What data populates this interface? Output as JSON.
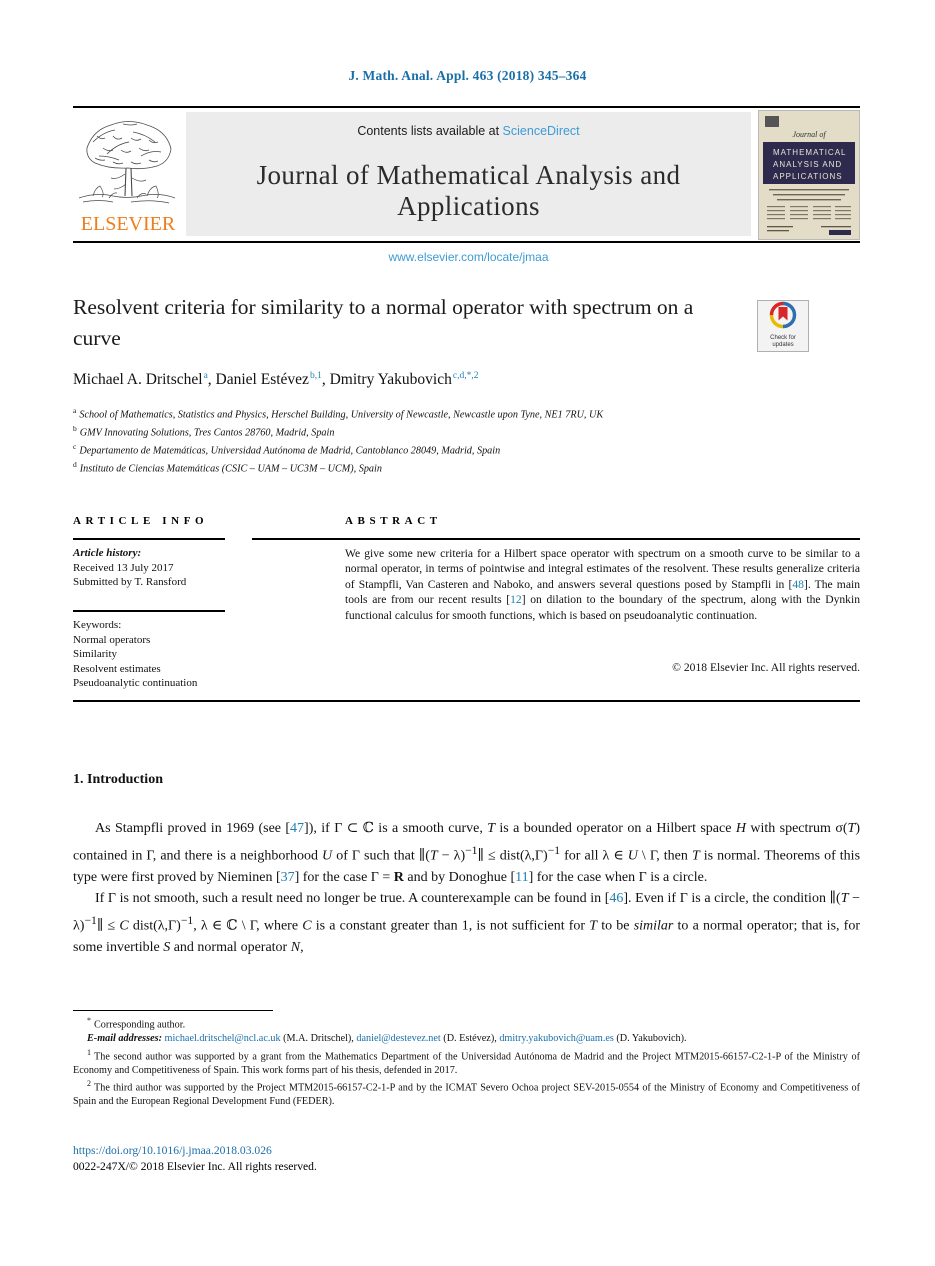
{
  "running_head": "J. Math. Anal. Appl. 463 (2018) 345–364",
  "masthead": {
    "contents_prefix": "Contents lists available at ",
    "sciencedirect": "ScienceDirect",
    "journal_name": "Journal of Mathematical Analysis and Applications",
    "journal_url": "www.elsevier.com/locate/jmaa",
    "publisher_wordmark": "ELSEVIER",
    "cover_journal_of": "Journal of",
    "cover_title_line1": "MATHEMATICAL",
    "cover_title_line2": "ANALYSIS AND",
    "cover_title_line3": "APPLICATIONS"
  },
  "crossmark": {
    "line1": "Check for",
    "line2": "updates"
  },
  "article": {
    "title": "Resolvent criteria for similarity to a normal operator with spectrum on a curve",
    "authors_html": "Michael A. Dritschel<sup>a</sup>, Daniel Estévez<sup>b,1</sup>, Dmitry Yakubovich<sup>c,d,*,2</sup>",
    "affiliations": [
      {
        "mark": "a",
        "text": "School of Mathematics, Statistics and Physics, Herschel Building, University of Newcastle, Newcastle upon Tyne, NE1 7RU, UK"
      },
      {
        "mark": "b",
        "text": "GMV Innovating Solutions, Tres Cantos 28760, Madrid, Spain"
      },
      {
        "mark": "c",
        "text": "Departamento de Matemáticas, Universidad Autónoma de Madrid, Cantoblanco 28049, Madrid, Spain"
      },
      {
        "mark": "d",
        "text": "Instituto de Ciencias Matemáticas (CSIC – UAM – UC3M – UCM), Spain"
      }
    ]
  },
  "info": {
    "header": "ARTICLE INFO",
    "history_head": "Article history:",
    "received": "Received 13 July 2017",
    "submitted": "Submitted by T. Ransford",
    "keywords_head": "Keywords:",
    "keywords": [
      "Normal operators",
      "Similarity",
      "Resolvent estimates",
      "Pseudoanalytic continuation"
    ]
  },
  "abstract": {
    "header": "ABSTRACT",
    "text_html": "We give some new criteria for a Hilbert space operator with spectrum on a smooth curve to be similar to a normal operator, in terms of pointwise and integral estimates of the resolvent. These results generalize criteria of Stampfli, Van Casteren and Naboko, and answers several questions posed by Stampfli in [<span class=\"cit\">48</span>]. The main tools are from our recent results [<span class=\"cit\">12</span>] on dilation to the boundary of the spectrum, along with the Dynkin functional calculus for smooth functions, which is based on pseudoanalytic continuation.",
    "copyright": "© 2018 Elsevier Inc. All rights reserved."
  },
  "section": {
    "heading": "1. Introduction",
    "paragraph1_html": "As Stampfli proved in 1969 (see [<span class=\"cit\">47</span>]), if &Gamma; &sub; &#8450; is a smooth curve, <span class=\"mi\">T</span> is a bounded operator on a Hilbert space <span class=\"mi\">H</span> with spectrum &sigma;(<span class=\"mi\">T</span>) contained in &Gamma;, and there is a neighborhood <span class=\"mi\">U</span> of &Gamma; such that &#8741;(<span class=\"mi\">T</span> &minus; &lambda;)<sup>&minus;1</sup>&#8741; &le; dist(&lambda;,&Gamma;)<sup>&minus;1</sup> for all &lambda; &isin; <span class=\"mi\">U</span> \\ &Gamma;, then <span class=\"mi\">T</span> is normal. Theorems of this type were first proved by Nieminen [<span class=\"cit\">37</span>] for the case &Gamma; = <span class=\"bb\">R</span> and by Donoghue [<span class=\"cit\">11</span>] for the case when &Gamma; is a circle.",
    "paragraph2_html": "If &Gamma; is not smooth, such a result need no longer be true. A counterexample can be found in [<span class=\"cit\">46</span>]. Even if &Gamma; is a circle, the condition &#8741;(<span class=\"mi\">T</span> &minus; &lambda;)<sup>&minus;1</sup>&#8741; &le; <span class=\"mi\">C</span> dist(&lambda;,&Gamma;)<sup>&minus;1</sup>, &lambda; &isin; &#8450; \\ &Gamma;, where <span class=\"mi\">C</span> is a constant greater than 1, is not sufficient for <span class=\"mi\">T</span> to be <span class=\"mi\">similar</span> to a normal operator; that is, for some invertible <span class=\"mi\">S</span> and normal operator <span class=\"mi\">N</span>,"
  },
  "footnotes": {
    "corresponding": "Corresponding author.",
    "emails_html": "<span class=\"ital\">E-mail addresses:</span> <span class=\"lnk\">michael.dritschel@ncl.ac.uk</span> (M.A. Dritschel), <span class=\"lnk\">daniel@destevez.net</span> (D. Estévez), <span class=\"lnk\">dmitry.yakubovich@uam.es</span> (D. Yakubovich).",
    "note1": "The second author was supported by a grant from the Mathematics Department of the Universidad Autónoma de Madrid and the Project MTM2015-66157-C2-1-P of the Ministry of Economy and Competitiveness of Spain. This work forms part of his thesis, defended in 2017.",
    "note2": "The third author was supported by the Project MTM2015-66157-C2-1-P and by the ICMAT Severo Ochoa project SEV-2015-0554 of the Ministry of Economy and Competitiveness of Spain and the European Regional Development Fund (FEDER)."
  },
  "footer": {
    "doi": "https://doi.org/10.1016/j.jmaa.2018.03.026",
    "issn_line": "0022-247X/© 2018 Elsevier Inc. All rights reserved."
  },
  "colors": {
    "link_blue": "#1b6fa8",
    "sciencedirect_blue": "#3d9bd4",
    "elsevier_orange": "#ef7d1a",
    "citation_blue": "#1f7fb0",
    "cover_navy": "#2e2a4e"
  }
}
